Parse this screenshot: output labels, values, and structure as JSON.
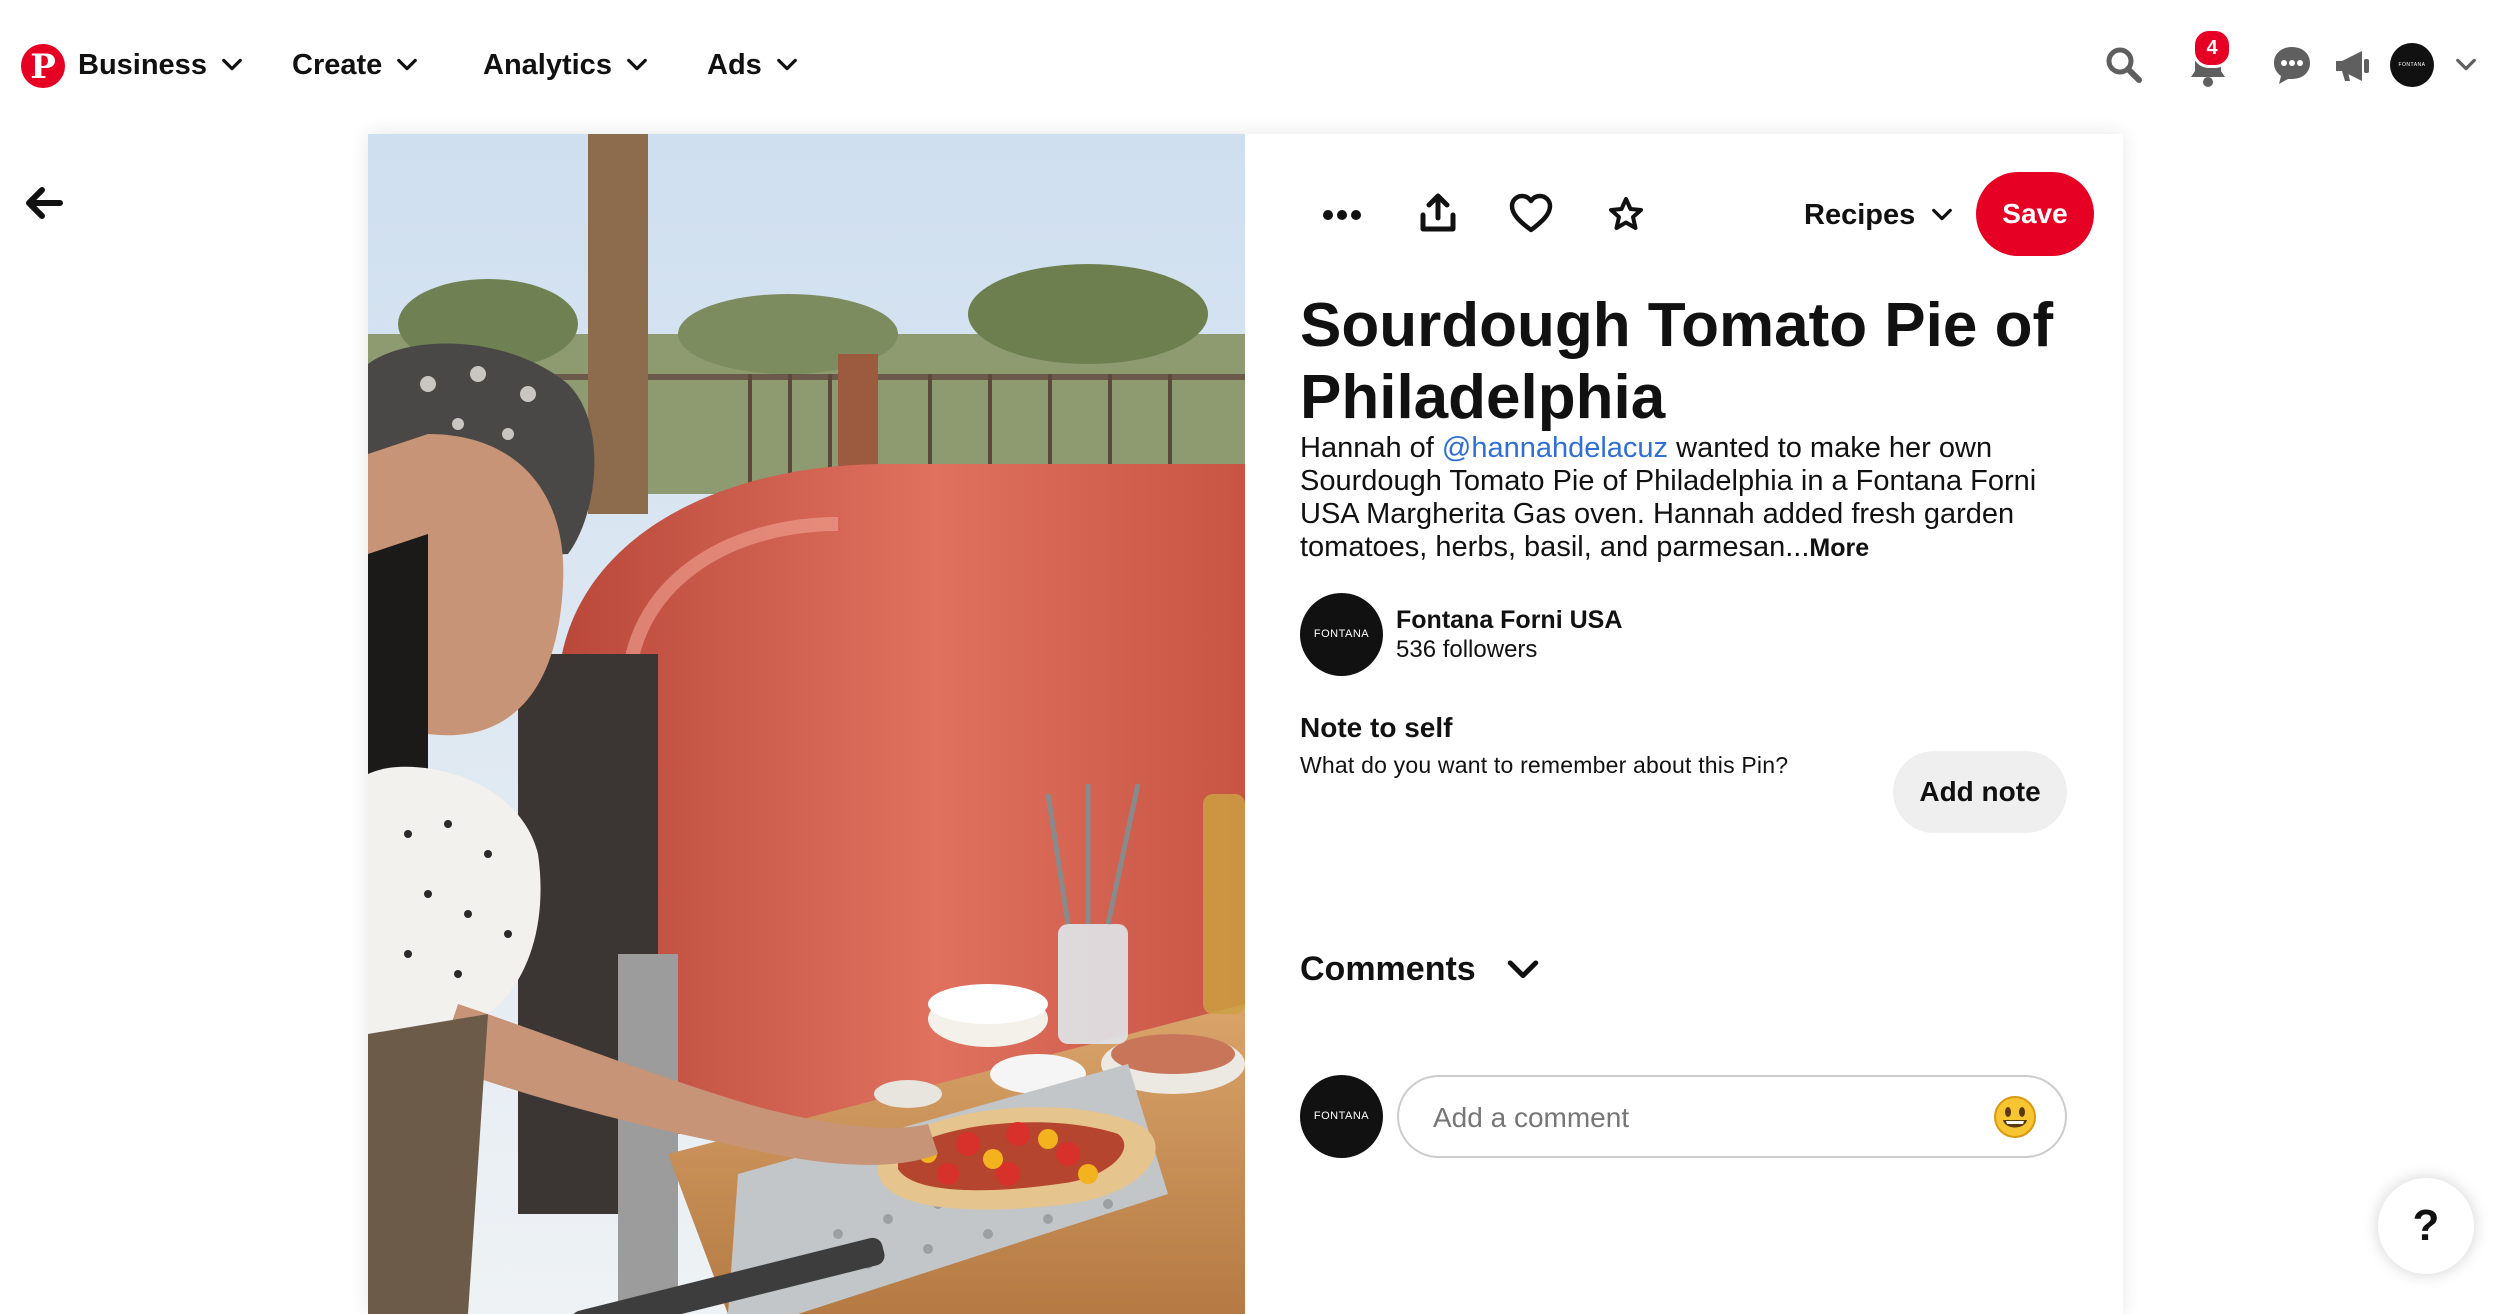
{
  "nav": {
    "logo_letter": "P",
    "items": [
      {
        "label": "Business"
      },
      {
        "label": "Create"
      },
      {
        "label": "Analytics"
      },
      {
        "label": "Ads"
      }
    ],
    "notification_count": "4",
    "avatar_text": "FONTANA",
    "icons": [
      "search-icon",
      "bell-icon",
      "chat-icon",
      "megaphone-icon",
      "chevron-down-icon"
    ]
  },
  "pin": {
    "board_label": "Recipes",
    "save_label": "Save",
    "title": "Sourdough Tomato Pie of Philadelphia",
    "description": {
      "prefix": "Hannah of ",
      "mention": "@hannahdelacuz",
      "body": " wanted to make her own Sourdough Tomato Pie of Philadelphia in a Fontana Forni USA Margherita Gas oven. Hannah added fresh garden tomatoes, herbs, basil, and parmesan...",
      "more": "More"
    },
    "creator": {
      "name": "Fontana Forni USA",
      "followers": "536 followers",
      "avatar_text": "FONTANA"
    },
    "note": {
      "title": "Note to self",
      "subtitle": "What do you want to remember about this Pin?",
      "button": "Add note"
    },
    "comments": {
      "label": "Comments",
      "placeholder": "Add a comment",
      "avatar_text": "FONTANA"
    }
  },
  "help": {
    "label": "?"
  },
  "colors": {
    "brand_red": "#e60023",
    "mention_blue": "#2f6fd6"
  }
}
